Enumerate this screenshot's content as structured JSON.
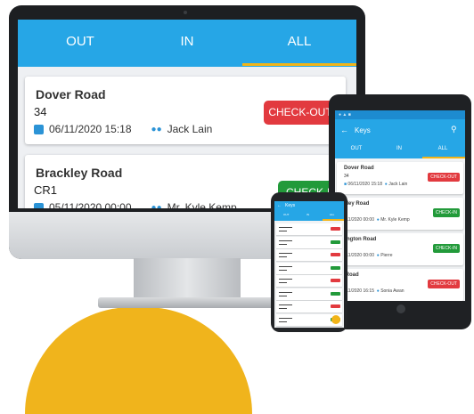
{
  "colors": {
    "primary": "#26a6e6",
    "accent": "#f2b418",
    "checkout": "#e23a3f",
    "checkin": "#229a3a"
  },
  "monitor": {
    "tabs": [
      "OUT",
      "IN",
      "ALL"
    ],
    "selected_tab": "ALL",
    "cards": [
      {
        "title": "Dover Road",
        "code": "34",
        "datetime": "06/11/2020 15:18",
        "person": "Jack Lain",
        "action": "CHECK-OUT"
      },
      {
        "title": "Brackley Road",
        "code": "CR1",
        "datetime": "05/11/2020 00:00",
        "person": "Mr. Kyle Kemp",
        "action": "CHECK-IN"
      }
    ]
  },
  "tablet": {
    "title": "Keys",
    "tabs": [
      "OUT",
      "IN",
      "ALL"
    ],
    "selected_tab": "ALL",
    "cards": [
      {
        "title": "Dover Road",
        "code": "34",
        "datetime": "06/11/2020 15:18",
        "person": "Jack Lain",
        "action": "CHECK-OUT"
      },
      {
        "title": "rackley Road",
        "code": "R1",
        "datetime": "05/11/2020 00:00",
        "person": "Mr. Kyle Kemp",
        "action": "CHECK-IN"
      },
      {
        "title": "ashington Road",
        "code": "109",
        "datetime": "06/11/2020 00:00",
        "person": "Pierre",
        "action": "CHECK-IN"
      },
      {
        "title": "ver Road",
        "code": "9",
        "datetime": "06/11/2020 16:15",
        "person": "Sonia Awan",
        "action": "CHECK-OUT"
      }
    ]
  },
  "phone": {
    "title": "Keys",
    "tabs": [
      "OUT",
      "IN",
      "ALL"
    ],
    "rows": [
      "checkout",
      "checkin",
      "checkout",
      "checkin",
      "checkout",
      "checkin",
      "checkout",
      "checkin"
    ]
  }
}
